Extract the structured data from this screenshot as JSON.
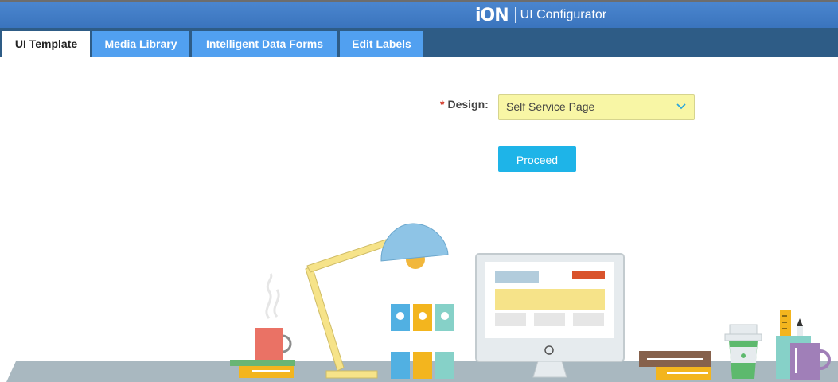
{
  "header": {
    "logo_text": "iON",
    "app_title": "UI Configurator",
    "colors": {
      "header_blue": "#4b86cf",
      "tabbar_dark": "#2e5c86",
      "tab_blue": "#51a0f0"
    }
  },
  "tabs": [
    {
      "label": "UI Template",
      "active": true
    },
    {
      "label": "Media Library",
      "active": false
    },
    {
      "label": "Intelligent Data Forms",
      "active": false
    },
    {
      "label": "Edit Labels",
      "active": false
    }
  ],
  "form": {
    "design_required_marker": "*",
    "design_label": "Design:",
    "design_value": "Self Service Page",
    "select_icon": "chevron-down-icon",
    "select_bg": "#f8f6a5",
    "proceed_label": "Proceed",
    "proceed_color": "#1eb4e8"
  }
}
